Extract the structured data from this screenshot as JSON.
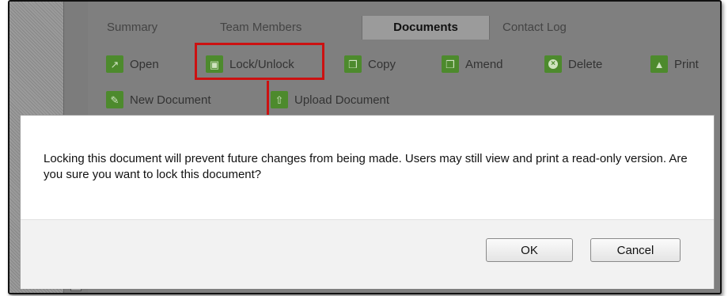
{
  "tabs": [
    {
      "label": "Summary"
    },
    {
      "label": "Team Members"
    },
    {
      "label": "Documents"
    },
    {
      "label": "Contact Log"
    }
  ],
  "toolbar": {
    "open": {
      "label": "Open",
      "icon": "open-icon"
    },
    "lock": {
      "label": "Lock/Unlock",
      "icon": "lock-icon"
    },
    "copy": {
      "label": "Copy",
      "icon": "copy-icon"
    },
    "amend": {
      "label": "Amend",
      "icon": "amend-icon"
    },
    "delete": {
      "label": "Delete",
      "icon": "delete-icon"
    },
    "print": {
      "label": "Print",
      "icon": "print-icon"
    },
    "new_document": {
      "label": "New Document",
      "icon": "pencil-icon"
    },
    "upload_document": {
      "label": "Upload Document",
      "icon": "upload-icon"
    }
  },
  "dialog": {
    "message": "Locking this document will prevent future changes from being made. Users may still view and print a read-only version. Are you sure you want to lock this document?",
    "ok_label": "OK",
    "cancel_label": "Cancel"
  },
  "colors": {
    "accent_green": "#4d8a2d",
    "highlight_red": "#cc1111"
  }
}
